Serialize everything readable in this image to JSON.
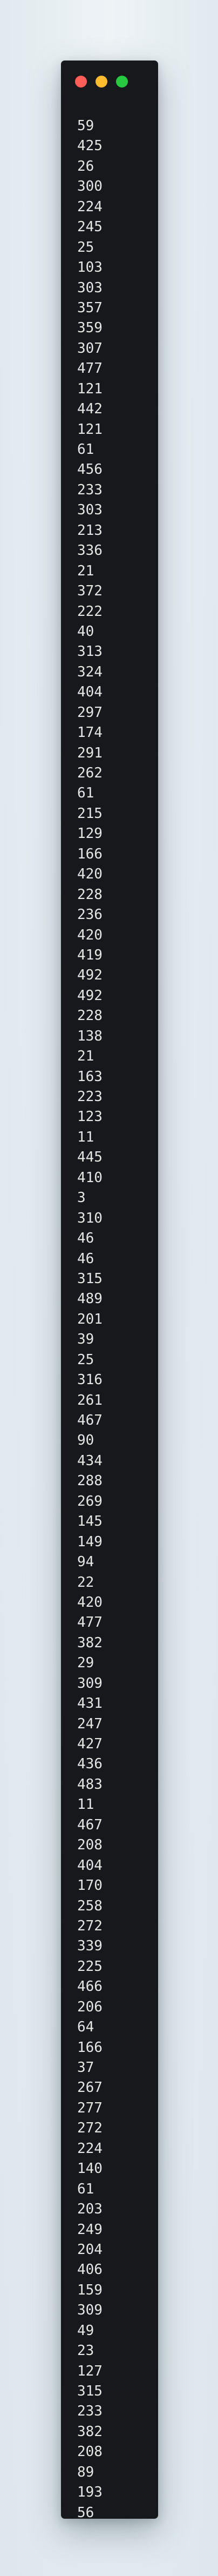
{
  "window": {
    "controls": {
      "close_color": "#ff5f57",
      "minimize_color": "#febc2e",
      "zoom_color": "#28c840"
    }
  },
  "terminal": {
    "lines": [
      "59",
      "425",
      "26",
      "300",
      "224",
      "245",
      "25",
      "103",
      "303",
      "357",
      "359",
      "307",
      "477",
      "121",
      "442",
      "121",
      "61",
      "456",
      "233",
      "303",
      "213",
      "336",
      "21",
      "372",
      "222",
      "40",
      "313",
      "324",
      "404",
      "297",
      "174",
      "291",
      "262",
      "61",
      "215",
      "129",
      "166",
      "420",
      "228",
      "236",
      "420",
      "419",
      "492",
      "492",
      "228",
      "138",
      "21",
      "163",
      "223",
      "123",
      "11",
      "445",
      "410",
      "3",
      "310",
      "46",
      "46",
      "315",
      "489",
      "201",
      "39",
      "25",
      "316",
      "261",
      "467",
      "90",
      "434",
      "288",
      "269",
      "145",
      "149",
      "94",
      "22",
      "420",
      "477",
      "382",
      "29",
      "309",
      "431",
      "247",
      "427",
      "436",
      "483",
      "11",
      "467",
      "208",
      "404",
      "170",
      "258",
      "272",
      "339",
      "225",
      "466",
      "206",
      "64",
      "166",
      "37",
      "267",
      "277",
      "272",
      "224",
      "140",
      "61",
      "203",
      "249",
      "204",
      "406",
      "159",
      "309",
      "49",
      "23",
      "127",
      "315",
      "233",
      "382",
      "208",
      "89",
      "193",
      "56"
    ]
  }
}
